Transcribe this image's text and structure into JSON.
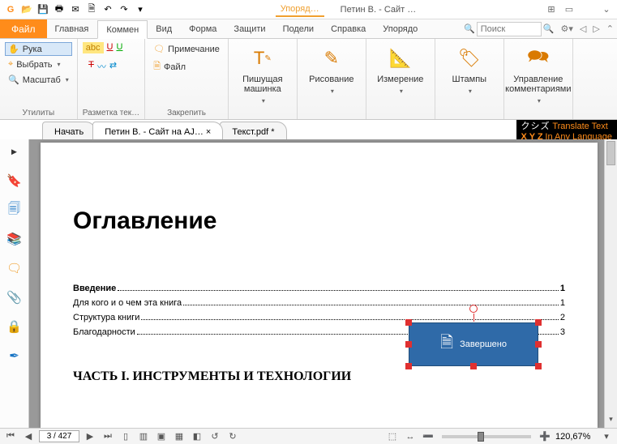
{
  "titlebar": {
    "mode": "Упоряд…",
    "doctitle": "Петин В. - Сайт …"
  },
  "menu": {
    "file": "Файл",
    "tabs": [
      "Главная",
      "Коммен",
      "Вид",
      "Форма",
      "Защити",
      "Подели",
      "Справка",
      "Упорядо"
    ],
    "active_index": 1,
    "search_placeholder": "Поиск"
  },
  "ribbon": {
    "g1": {
      "hand": "Рука",
      "select": "Выбрать",
      "zoom": "Масштаб",
      "label": "Утилиты"
    },
    "g2": {
      "label": "Разметка тек…"
    },
    "g3": {
      "note": "Примечание",
      "file": "Файл",
      "label": "Закрепить"
    },
    "g4": {
      "label1": "Пишущая",
      "label2": "машинка"
    },
    "g5": {
      "label": "Рисование"
    },
    "g6": {
      "label": "Измерение"
    },
    "g7": {
      "label": "Штампы"
    },
    "g8": {
      "label1": "Управление",
      "label2": "комментариями"
    }
  },
  "doctabs": {
    "items": [
      {
        "label": "Начать"
      },
      {
        "label": "Петин В. - Сайт на AJ… ×"
      },
      {
        "label": "Текст.pdf *"
      }
    ],
    "active_index": 1
  },
  "ad": {
    "jp": "クシズ",
    "line1": "Translate Text",
    "line2": "In Any Language",
    "xyz": "X Y Z"
  },
  "page": {
    "title": "Оглавление",
    "toc": [
      {
        "t": "Введение",
        "p": "1",
        "bold": true
      },
      {
        "t": "Для кого и о чем эта книга",
        "p": "1",
        "bold": false
      },
      {
        "t": "Структура книги",
        "p": "2",
        "bold": false
      },
      {
        "t": "Благодарности",
        "p": "3",
        "bold": false
      }
    ],
    "part": "ЧАСТЬ I. ИНСТРУМЕНТЫ И ТЕХНОЛОГИИ"
  },
  "stamp": {
    "text": "Завершено"
  },
  "status": {
    "page_field": "3 / 427",
    "zoom": "120,67%"
  }
}
